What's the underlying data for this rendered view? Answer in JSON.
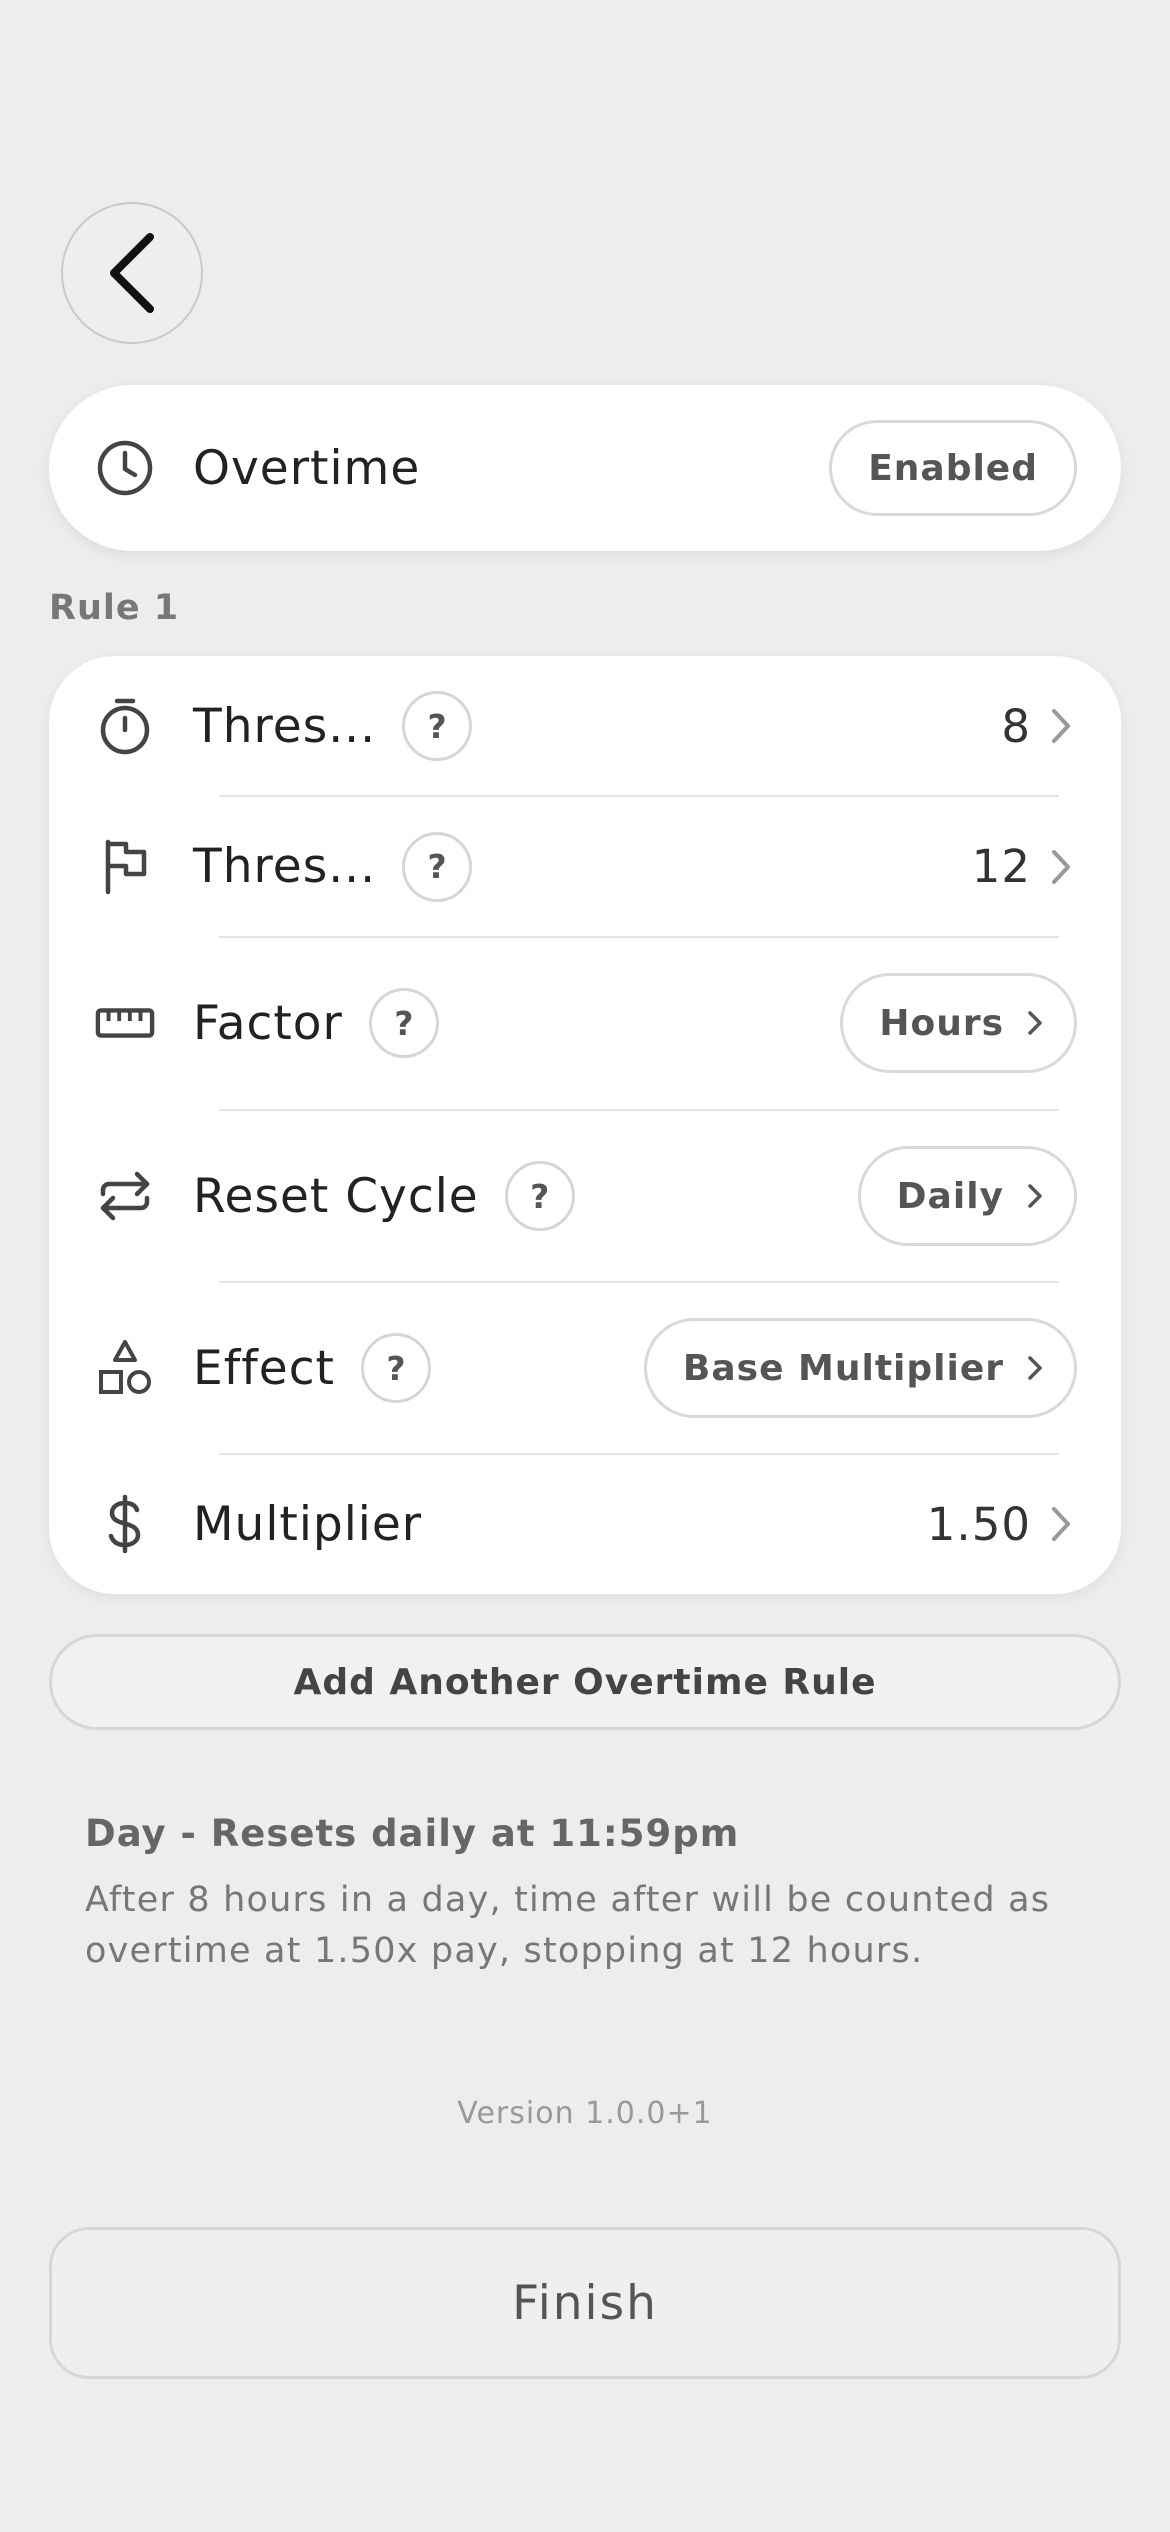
{
  "header": {
    "back_icon": "chevron-left-icon"
  },
  "overtime": {
    "title": "Overtime",
    "icon": "clock-icon",
    "status": "Enabled"
  },
  "rule": {
    "label": "Rule 1",
    "rows": [
      {
        "icon": "stopwatch-icon",
        "label": "Thres...",
        "help": "?",
        "value": "8"
      },
      {
        "icon": "flag-icon",
        "label": "Thres...",
        "help": "?",
        "value": "12"
      },
      {
        "icon": "ruler-icon",
        "label": "Factor",
        "help": "?",
        "value": "Hours"
      },
      {
        "icon": "repeat-icon",
        "label": "Reset Cycle",
        "help": "?",
        "value": "Daily"
      },
      {
        "icon": "shapes-icon",
        "label": "Effect",
        "help": "?",
        "value": "Base Multiplier"
      },
      {
        "icon": "dollar-icon",
        "label": "Multiplier",
        "value": "1.50"
      }
    ]
  },
  "add_rule_label": "Add Another Overtime Rule",
  "summary": {
    "title": "Day - Resets daily at 11:59pm",
    "text": "After 8 hours in a day, time after will be counted as overtime at 1.50x pay, stopping at 12 hours."
  },
  "version": "Version 1.0.0+1",
  "finish_label": "Finish",
  "colors": {
    "background": "#ededed",
    "card": "#ffffff",
    "border": "#d6d6d6"
  }
}
